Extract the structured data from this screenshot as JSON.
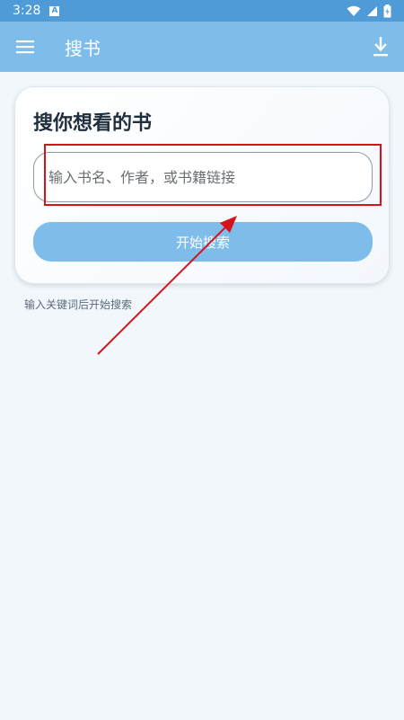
{
  "status_bar": {
    "time": "3:28",
    "notification_icon": "a-icon",
    "wifi_icon": "wifi-icon",
    "signal_icon": "signal-icon",
    "battery_icon": "battery-icon"
  },
  "app_bar": {
    "title": "搜书",
    "menu_icon": "menu-icon",
    "download_icon": "download-icon",
    "color": "#7ebdea"
  },
  "card": {
    "title": "搜你想看的书",
    "search_placeholder": "输入书名、作者，或书籍链接",
    "search_value": "",
    "search_button_label": "开始搜索"
  },
  "hint": "输入关键词后开始搜索",
  "annotation": {
    "highlight_color": "#d8121a",
    "arrow_color": "#d8121a"
  }
}
